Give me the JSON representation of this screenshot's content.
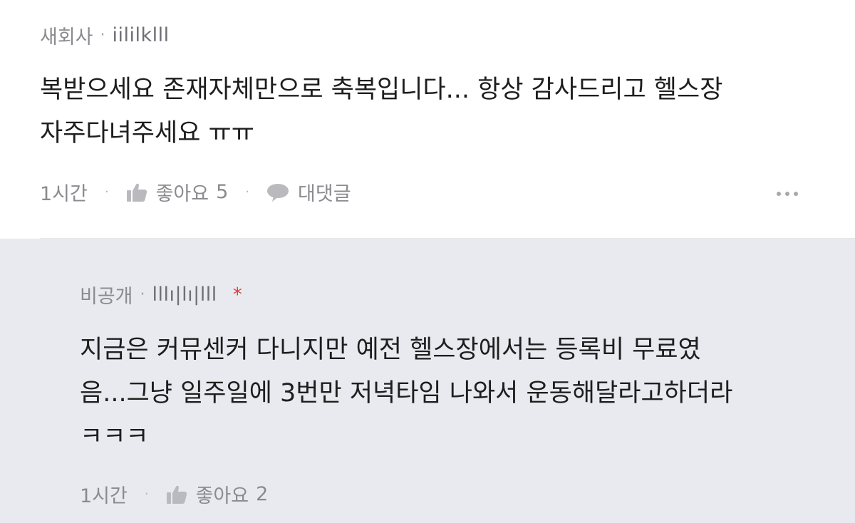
{
  "comments": [
    {
      "author": "새회사",
      "username": "iililklll",
      "body_lines": [
        "복받으세요 존재자체만으로 축복입니다... 항상 감사드리고 헬스장",
        "자주다녀주세요 ㅠㅠ"
      ],
      "time": "1시간",
      "like_label": "좋아요",
      "like_count": "5",
      "reply_label": "대댓글"
    },
    {
      "author": "비공개",
      "username": "lllı|lı|lll",
      "badge": "*",
      "body_lines": [
        "지금은 커뮤센커 다니지만 예전 헬스장에서는 등록비 무료였",
        "음...그냥 일주일에 3번만 저녁타임 나와서 운동해달라고하더라",
        "ㅋㅋㅋ"
      ],
      "time": "1시간",
      "like_label": "좋아요",
      "like_count": "2"
    }
  ],
  "separator": "·",
  "icons": {
    "like": "thumbs-up-icon",
    "reply": "speech-bubble-icon",
    "more": "more-dots-icon"
  },
  "colors": {
    "reply_background": "#e9eaef",
    "badge": "#e23a3a",
    "meta_text": "#8a8a8f"
  }
}
